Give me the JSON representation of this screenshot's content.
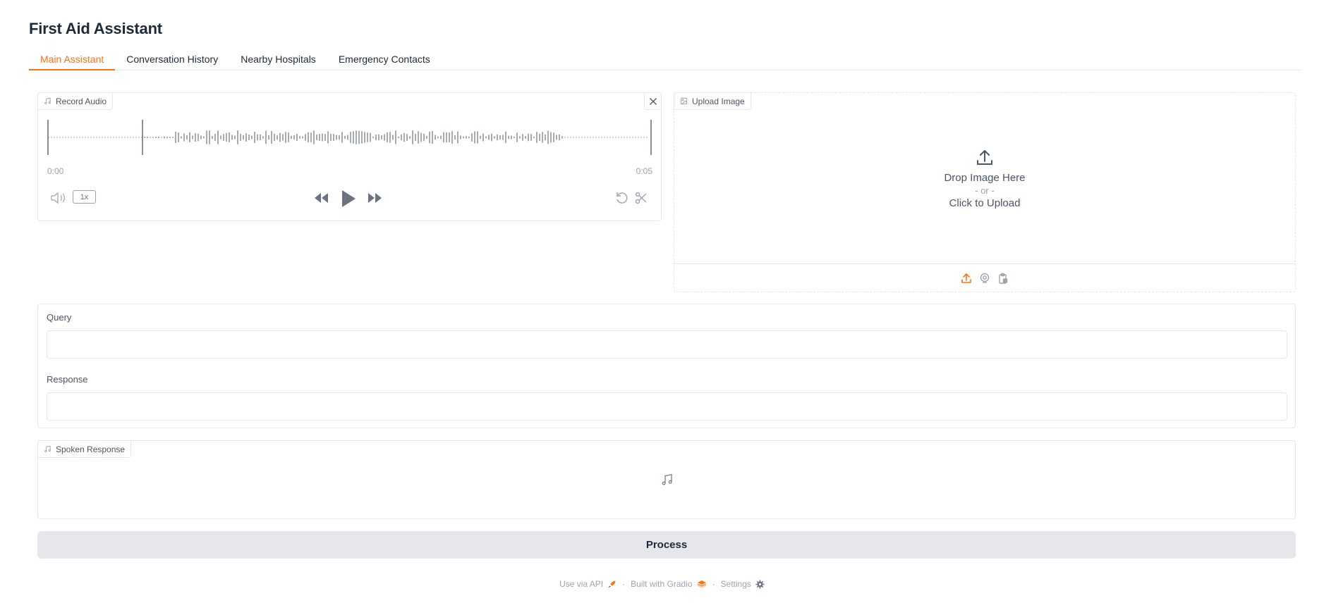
{
  "app": {
    "title": "First Aid Assistant"
  },
  "tabs": [
    {
      "label": "Main Assistant",
      "active": true
    },
    {
      "label": "Conversation History",
      "active": false
    },
    {
      "label": "Nearby Hospitals",
      "active": false
    },
    {
      "label": "Emergency Contacts",
      "active": false
    }
  ],
  "audio_input": {
    "label": "Record Audio",
    "icon": "music-note-icon",
    "time_start": "0:00",
    "time_end": "0:05",
    "playback_rate": "1x"
  },
  "image_input": {
    "label": "Upload Image",
    "drop_text": "Drop Image Here",
    "or_text": "- or -",
    "click_text": "Click to Upload",
    "accent_color": "#f97316"
  },
  "query": {
    "label": "Query",
    "value": ""
  },
  "response": {
    "label": "Response",
    "value": ""
  },
  "spoken_response": {
    "label": "Spoken Response"
  },
  "process_button": {
    "label": "Process"
  },
  "footer": {
    "api_label": "Use via API",
    "built_label": "Built with Gradio",
    "settings_label": "Settings",
    "separator": "·"
  }
}
